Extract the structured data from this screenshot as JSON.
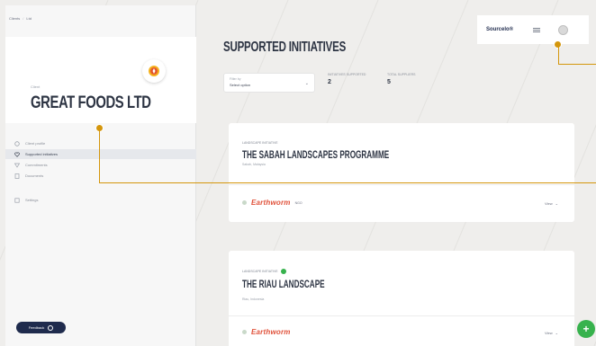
{
  "breadcrumb": {
    "items": [
      "Clients",
      "Ltd"
    ]
  },
  "company": {
    "type_label": "Client",
    "name": "GREAT FOODS LTD"
  },
  "sidebar": {
    "items": [
      {
        "label": "Client profile",
        "icon": "circle-icon",
        "active": false
      },
      {
        "label": "Supported initiatives",
        "icon": "heart-icon",
        "active": true
      },
      {
        "label": "Commitments",
        "icon": "target-icon",
        "active": false
      },
      {
        "label": "Documents",
        "icon": "document-icon",
        "active": false
      },
      {
        "label": "Settings",
        "icon": "settings-icon",
        "active": false
      }
    ],
    "feedback_label": "Feedback"
  },
  "header": {
    "brand": "Sourcelo®",
    "page_title": "SUPPORTED INITIATIVES"
  },
  "filters": {
    "select_label": "Filter by",
    "select_value": "Select option",
    "stats": [
      {
        "label": "INITIATIVES SUPPORTED",
        "value": "2"
      },
      {
        "label": "TOTAL SUPPLIERS",
        "value": "5"
      }
    ]
  },
  "initiatives": [
    {
      "type_label": "LANDSCAPE INITIATIVE",
      "title": "THE SABAH LANDSCAPES PROGRAMME",
      "location": "Sabah, Malaysia",
      "org_name": "Earthworm",
      "org_tag": "NGO",
      "view_label": "View"
    },
    {
      "type_label": "LANDSCAPE INITIATIVE",
      "title": "THE RIAU LANDSCAPE",
      "location": "Riau, Indonesia",
      "org_name": "Earthworm",
      "org_tag": "",
      "view_label": "View"
    }
  ],
  "colors": {
    "accent_callout": "#d4960c",
    "brand_navy": "#1f2b4d",
    "org_red": "#e0513a",
    "success_green": "#37b24d"
  }
}
